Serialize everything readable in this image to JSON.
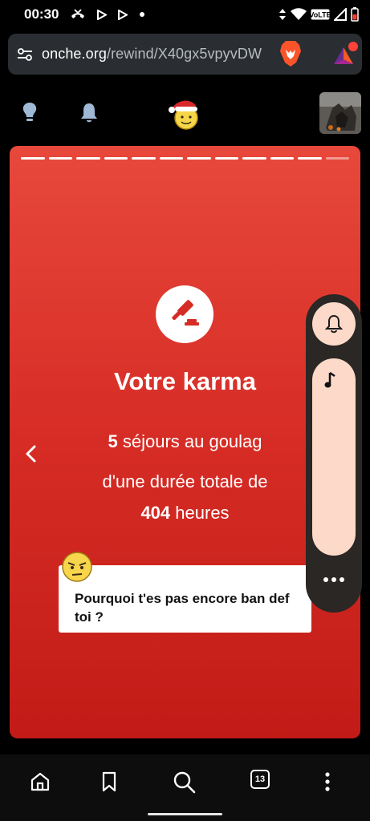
{
  "status_bar": {
    "time": "00:30",
    "icons": [
      "missed-call-icon",
      "play-store-icon",
      "play-icon",
      "dot-icon",
      "data-arrows-icon",
      "wifi-icon",
      "volte-icon",
      "signal-icon",
      "battery-low-icon"
    ],
    "volte_label": "VoLTE"
  },
  "browser": {
    "url_host": "onche.org",
    "url_path": "/rewind/X40gx5vpyvDW",
    "tab_count": "13"
  },
  "header": {
    "icons": [
      "lightbulb-icon",
      "bell-icon",
      "santa-hat-smiley-logo",
      "avatar"
    ]
  },
  "story": {
    "title": "Votre karma",
    "stays_count": "5",
    "stays_label": "séjours au goulag",
    "duration_prefix": "d'une durée totale de",
    "hours_value": "404",
    "hours_label": "heures",
    "quote": "Pourquoi t'es pas encore ban def toi ?",
    "progress_total": 12,
    "progress_current": 11
  },
  "colors": {
    "card_top": "#e8483b",
    "card_bottom": "#c21b17",
    "side_panel": "#2b2725",
    "side_accent": "#fcd9c9",
    "url_bar": "#2a2d31"
  }
}
